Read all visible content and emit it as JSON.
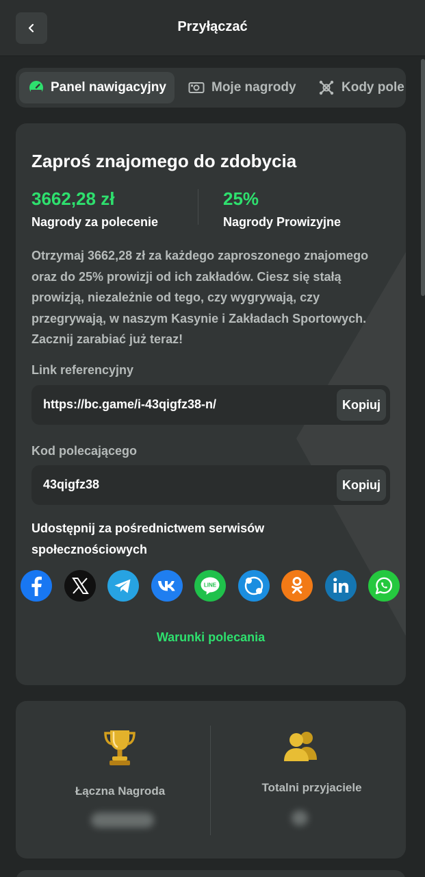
{
  "header": {
    "title": "Przyłączać",
    "back_icon": "chevron-left-icon"
  },
  "tabs": [
    {
      "label": "Panel nawigacyjny",
      "icon": "dashboard-icon",
      "active": true
    },
    {
      "label": "Moje nagrody",
      "icon": "cash-icon",
      "active": false
    },
    {
      "label": "Kody pole",
      "icon": "code-icon",
      "active": false
    }
  ],
  "invite": {
    "title": "Zaproś znajomego do zdobycia",
    "stats": [
      {
        "value": "3662,28 zł",
        "label": "Nagrody za polecenie"
      },
      {
        "value": "25%",
        "label": "Nagrody Prowizyjne"
      }
    ],
    "description": "Otrzymaj 3662,28 zł za każdego zaproszonego znajomego oraz do 25% prowizji od ich zakładów. Ciesz się stałą prowizją, niezależnie od tego, czy wygrywają, czy przegrywają, w naszym Kasynie i Zakładach Sportowych. Zacznij zarabiać już teraz!",
    "link_label": "Link referencyjny",
    "link_value": "https://bc.game/i-43qigfz38-n/",
    "code_label": "Kod polecającego",
    "code_value": "43qigfz38",
    "copy_label": "Kopiuj",
    "share_label": "Udostępnij za pośrednictwem serwisów społecznościowych",
    "socials": [
      {
        "name": "facebook",
        "color": "#1877f2"
      },
      {
        "name": "x",
        "color": "#101010"
      },
      {
        "name": "telegram",
        "color": "#27a3e2"
      },
      {
        "name": "vk",
        "color": "#1f7ef0"
      },
      {
        "name": "line",
        "color": "#1fc14b"
      },
      {
        "name": "skype",
        "color": "#1b8ee0"
      },
      {
        "name": "odnoklassniki",
        "color": "#f27a16"
      },
      {
        "name": "linkedin",
        "color": "#1576b2"
      },
      {
        "name": "whatsapp",
        "color": "#25c83f"
      }
    ],
    "terms_link": "Warunki polecania"
  },
  "summary": {
    "total_reward_label": "Łączna Nagroda",
    "total_friends_label": "Totalni przyjaciele"
  },
  "colors": {
    "accent": "#2ee06e",
    "card": "#323636",
    "background": "#232626"
  }
}
